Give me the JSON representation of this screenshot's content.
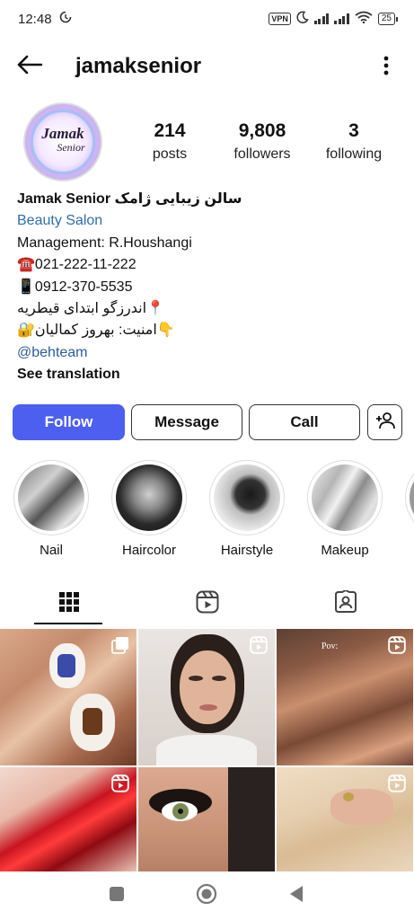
{
  "status_bar": {
    "time": "12:48",
    "vpn_label": "VPN",
    "battery": "25",
    "icons": [
      "sync-icon",
      "moon-icon",
      "signal-icon",
      "wifi-icon",
      "battery-icon"
    ]
  },
  "header": {
    "username": "jamaksenior",
    "back_icon": "arrow-left-icon",
    "more_icon": "more-vertical-icon"
  },
  "avatar": {
    "logo_main": "Jamak",
    "logo_sub": "Senior"
  },
  "stats": {
    "posts": {
      "value": "214",
      "label": "posts"
    },
    "followers": {
      "value": "9,808",
      "label": "followers"
    },
    "following": {
      "value": "3",
      "label": "following"
    }
  },
  "bio": {
    "name": "سالن زیبایی ژامک Jamak Senior",
    "category": "Beauty Salon",
    "management": "Management: R.Houshangi",
    "phone": "☎️021-222-11-222",
    "mobile": "📱0912-370-5535",
    "address": "📍اندرزگو ابتدای قیطریه",
    "security": "👇امنیت: بهروز کمالیان🔐",
    "mention": "@behteam",
    "see_translation": "See translation"
  },
  "actions": {
    "follow": "Follow",
    "message": "Message",
    "call": "Call",
    "add_user_icon": "add-user-icon"
  },
  "highlights": [
    {
      "label": "Nail"
    },
    {
      "label": "Haircolor"
    },
    {
      "label": "Hairstyle"
    },
    {
      "label": "Makeup"
    }
  ],
  "tabs": [
    {
      "icon": "grid-icon",
      "active": true
    },
    {
      "icon": "reels-icon",
      "active": false
    },
    {
      "icon": "tagged-icon",
      "active": false
    }
  ],
  "grid_posts": [
    {
      "type": "multi",
      "icon": "carousel-icon"
    },
    {
      "type": "reel",
      "icon": "reels-icon"
    },
    {
      "type": "reel",
      "icon": "reels-icon",
      "overlay_text": "Pov:"
    },
    {
      "type": "reel",
      "icon": "reels-icon"
    },
    {
      "type": "image",
      "icon": ""
    },
    {
      "type": "reel",
      "icon": "reels-icon"
    }
  ],
  "colors": {
    "follow_button": "#4c5fef",
    "link": "#2d6ea8",
    "text": "#111111"
  },
  "nav_bar": {
    "icons": [
      "recent-apps-icon",
      "home-icon",
      "back-icon"
    ]
  }
}
